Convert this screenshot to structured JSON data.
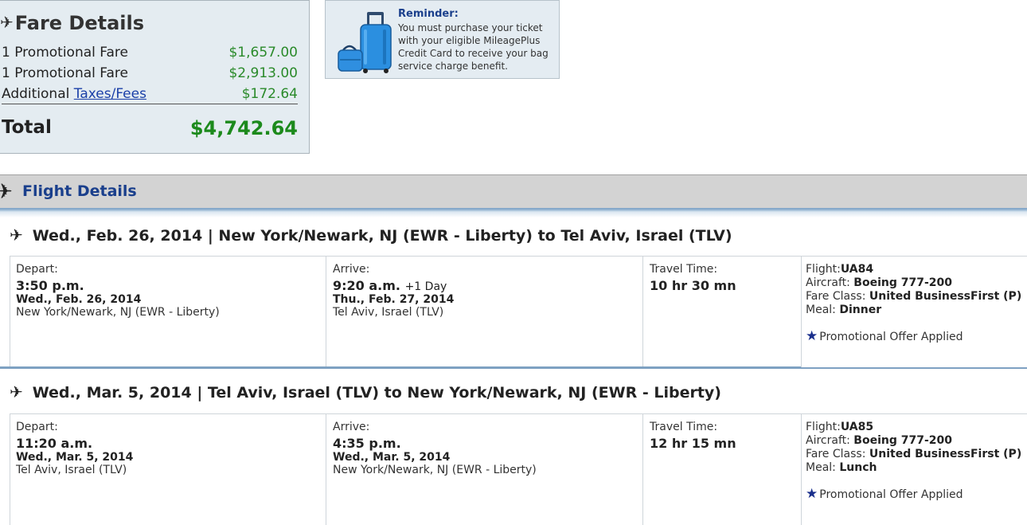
{
  "fare_details": {
    "title": "Fare Details",
    "rows": [
      {
        "label": "1 Promotional Fare",
        "amount": "$1,657.00"
      },
      {
        "label": "1 Promotional Fare",
        "amount": "$2,913.00"
      }
    ],
    "taxes": {
      "prefix": "Additional",
      "link": "Taxes/Fees",
      "amount": "$172.64"
    },
    "total_label": "Total",
    "total_amount": "$4,742.64"
  },
  "reminder": {
    "title": "Reminder:",
    "text": "You must purchase your ticket with your eligible MileagePlus Credit Card to receive your bag service charge benefit."
  },
  "flight_details": {
    "title": "Flight Details",
    "segments": [
      {
        "header": "Wed., Feb. 26, 2014 | New York/Newark, NJ (EWR - Liberty) to Tel Aviv, Israel (TLV)",
        "depart": {
          "label": "Depart:",
          "time": "3:50 p.m.",
          "date": "Wed., Feb. 26, 2014",
          "city": "New York/Newark, NJ (EWR - Liberty)"
        },
        "arrive": {
          "label": "Arrive:",
          "time": "9:20 a.m.",
          "plus": "+1 Day",
          "date": "Thu., Feb. 27, 2014",
          "city": "Tel Aviv, Israel (TLV)"
        },
        "travel": {
          "label": "Travel Time:",
          "value": "10 hr 30 mn"
        },
        "flight": {
          "flight_label": "Flight:",
          "flight": "UA84",
          "aircraft_label": "Aircraft:",
          "aircraft": "Boeing 777-200",
          "class_label": "Fare Class:",
          "class": "United BusinessFirst (P)",
          "meal_label": "Meal:",
          "meal": "Dinner",
          "promo": "Promotional Offer Applied"
        }
      },
      {
        "header": "Wed., Mar. 5, 2014 | Tel Aviv, Israel (TLV) to New York/Newark, NJ (EWR - Liberty)",
        "depart": {
          "label": "Depart:",
          "time": "11:20 a.m.",
          "date": "Wed., Mar. 5, 2014",
          "city": "Tel Aviv, Israel (TLV)"
        },
        "arrive": {
          "label": "Arrive:",
          "time": "4:35 p.m.",
          "plus": "",
          "date": "Wed., Mar. 5, 2014",
          "city": "New York/Newark, NJ (EWR - Liberty)"
        },
        "travel": {
          "label": "Travel Time:",
          "value": "12 hr 15 mn"
        },
        "flight": {
          "flight_label": "Flight:",
          "flight": "UA85",
          "aircraft_label": "Aircraft:",
          "aircraft": "Boeing 777-200",
          "class_label": "Fare Class:",
          "class": "United BusinessFirst (P)",
          "meal_label": "Meal:",
          "meal": "Lunch",
          "promo": "Promotional Offer Applied"
        }
      }
    ]
  },
  "icons": {
    "plane": "airplane-icon",
    "star": "star-icon",
    "luggage": "luggage-icon"
  },
  "colors": {
    "price_green": "#2a8a2a",
    "link_blue": "#1a3fa8",
    "title_blue": "#1a3f8c",
    "accent_bar": "#7ea1c2"
  }
}
